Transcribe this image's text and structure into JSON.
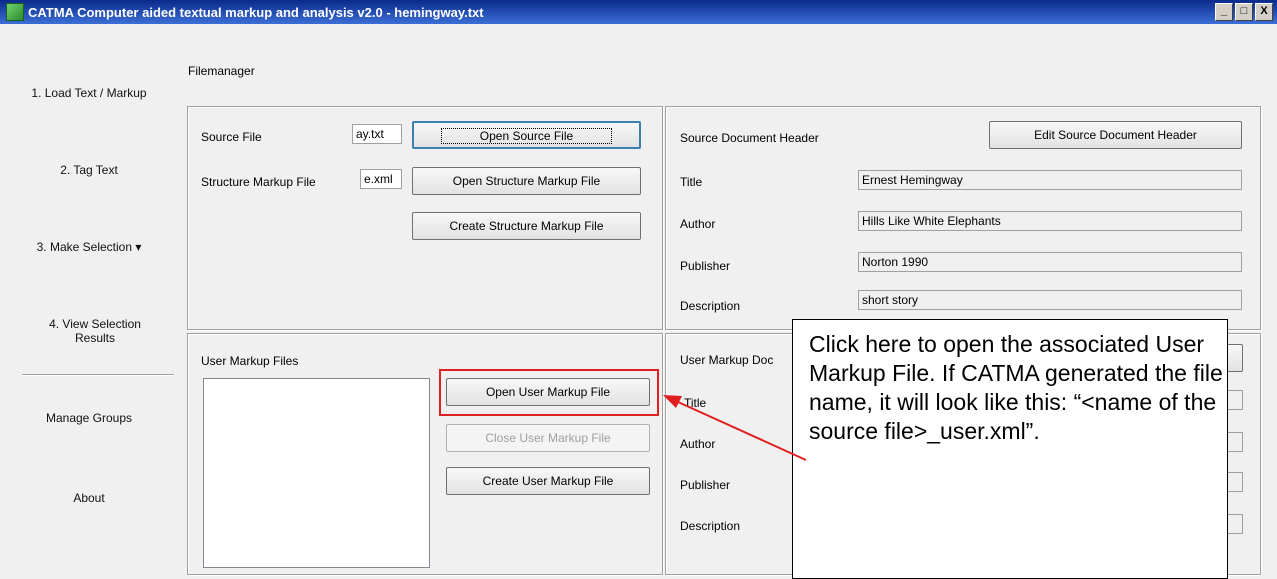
{
  "window": {
    "title": "CATMA Computer aided textual markup and analysis v2.0  - hemingway.txt",
    "minimize": "_",
    "maximize": "□",
    "close": "X"
  },
  "sidebar": {
    "items": [
      {
        "label": "1. Load Text / Markup"
      },
      {
        "label": "2. Tag Text"
      },
      {
        "label": "3. Make Selection ▾"
      },
      {
        "label": "4. View Selection Results"
      },
      {
        "label": "Manage Groups"
      },
      {
        "label": "About"
      }
    ]
  },
  "filemanager": {
    "label": "Filemanager",
    "source_file_label": "Source File",
    "source_file_value": "ay.txt",
    "open_source_button": "Open Source File",
    "structure_markup_label": "Structure Markup File",
    "structure_markup_value": "e.xml",
    "open_structure_button": "Open Structure Markup File",
    "create_structure_button": "Create Structure Markup File"
  },
  "source_header": {
    "label": "Source Document Header",
    "edit_button": "Edit Source Document Header",
    "fields": [
      {
        "label": "Title",
        "value": "Ernest Hemingway"
      },
      {
        "label": "Author",
        "value": "Hills Like White Elephants"
      },
      {
        "label": "Publisher",
        "value": "Norton 1990"
      },
      {
        "label": "Description",
        "value": "short story"
      }
    ]
  },
  "user_markup": {
    "label": "User Markup Files",
    "open_button": "Open User Markup File",
    "close_button": "Close User Markup File",
    "create_button": "Create User Markup File"
  },
  "user_header": {
    "label": "User Markup Doc",
    "fields": [
      {
        "label": "Title"
      },
      {
        "label": "Author"
      },
      {
        "label": "Publisher"
      },
      {
        "label": "Description"
      }
    ]
  },
  "callout": {
    "text": "Click here to open the associated User Markup File. If CATMA generated the file name, it will look like this: “<name of the source file>_user.xml”."
  },
  "colors": {
    "highlight": "#e02020",
    "titlebar": "#0b2a8c"
  }
}
